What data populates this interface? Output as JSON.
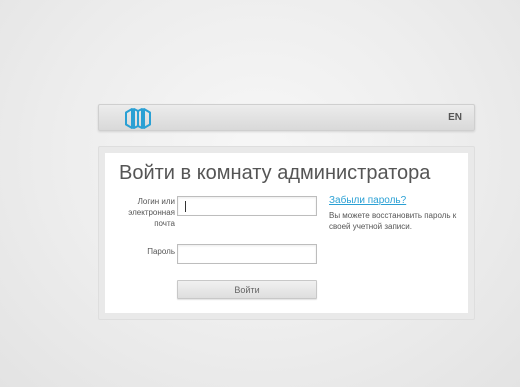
{
  "header": {
    "logo_icon": "brand-logo-icon",
    "lang_label": "EN",
    "accent_color": "#2aa0d4"
  },
  "login": {
    "title": "Войти в комнату администратора",
    "login_label": "Логин или электронная почта",
    "login_value": "",
    "password_label": "Пароль",
    "password_value": "",
    "forgot_link": "Забыли пароль?",
    "forgot_hint": "Вы можете восстановить пароль к своей учетной записи.",
    "submit_label": "Войти"
  }
}
